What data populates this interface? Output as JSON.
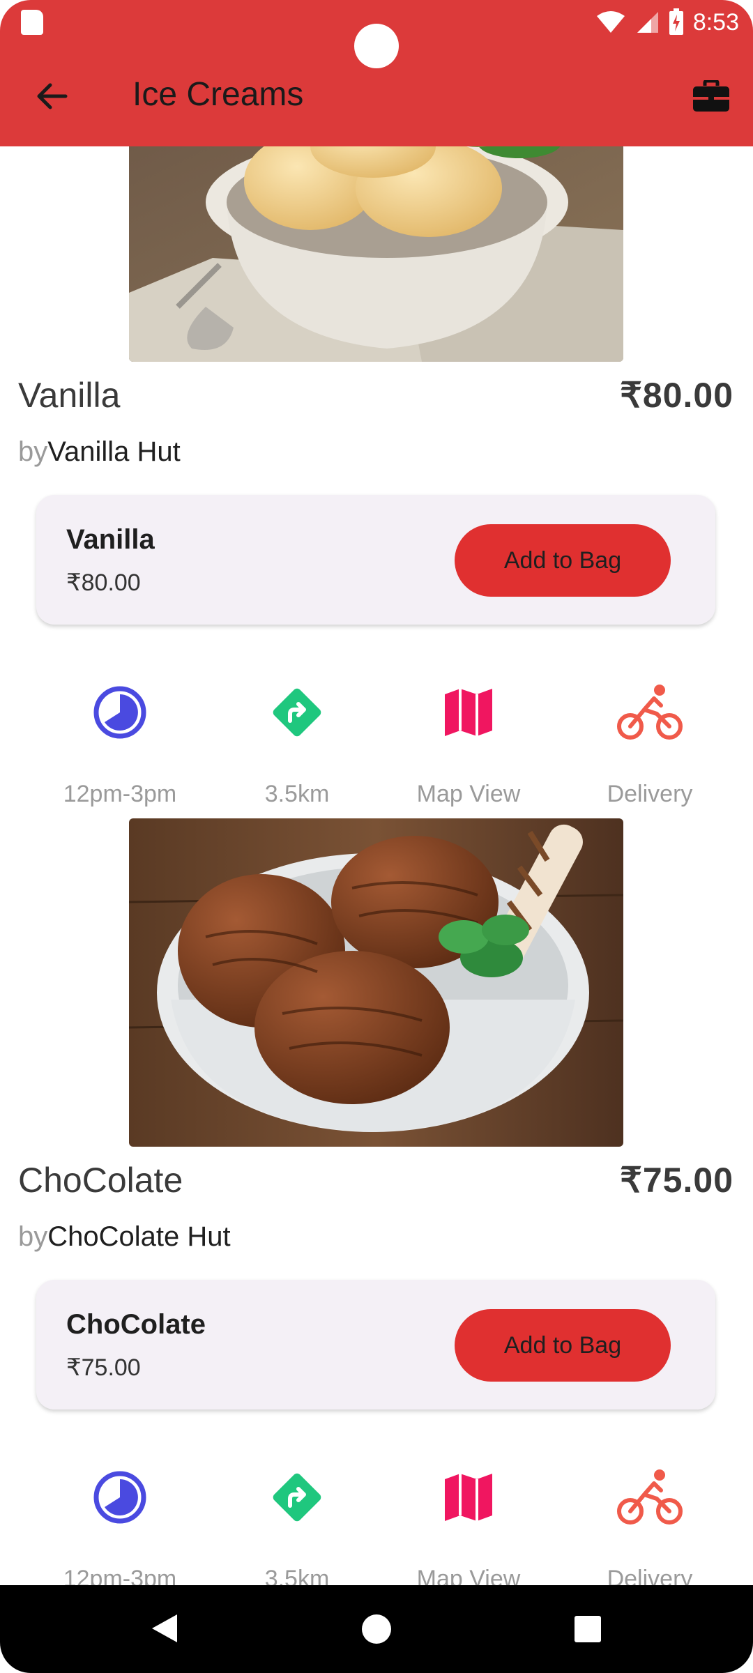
{
  "status": {
    "time": "8:53"
  },
  "appbar": {
    "title": "Ice Creams"
  },
  "items": [
    {
      "name": "Vanilla",
      "price": "₹80.00",
      "by_prefix": "by",
      "vendor": "Vanilla Hut",
      "card_name": "Vanilla",
      "card_price": "₹80.00",
      "add_label": "Add to Bag",
      "features": [
        {
          "icon": "clock-icon",
          "label": "12pm-3pm",
          "color": "#4a4ae0"
        },
        {
          "icon": "directions-icon",
          "label": "3.5km",
          "color": "#1fc77e"
        },
        {
          "icon": "map-icon",
          "label": "Map View",
          "color": "#f01660"
        },
        {
          "icon": "bicycle-icon",
          "label": "Delivery",
          "color": "#f05a4a"
        }
      ]
    },
    {
      "name": "ChoColate",
      "price": "₹75.00",
      "by_prefix": "by",
      "vendor": "ChoColate Hut",
      "card_name": "ChoColate",
      "card_price": "₹75.00",
      "add_label": "Add to Bag",
      "features": [
        {
          "icon": "clock-icon",
          "label": "12pm-3pm",
          "color": "#4a4ae0"
        },
        {
          "icon": "directions-icon",
          "label": "3.5km",
          "color": "#1fc77e"
        },
        {
          "icon": "map-icon",
          "label": "Map View",
          "color": "#f01660"
        },
        {
          "icon": "bicycle-icon",
          "label": "Delivery",
          "color": "#f05a4a"
        }
      ]
    }
  ],
  "colors": {
    "primary": "#dc3a3a",
    "button": "#e03030",
    "card": "#f4f0f6"
  }
}
